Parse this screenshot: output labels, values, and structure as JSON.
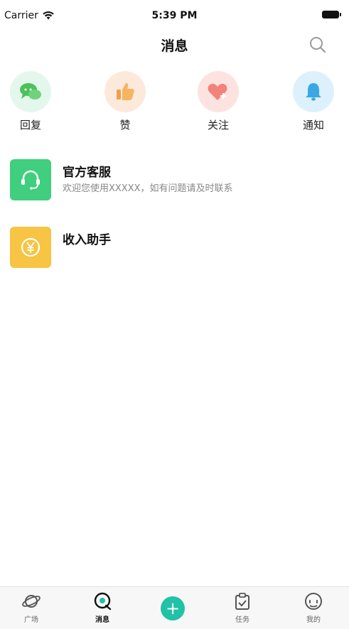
{
  "status_bar": {
    "carrier": "Carrier",
    "time": "5:39 PM"
  },
  "nav": {
    "title": "消息",
    "search_icon": "search-icon"
  },
  "quick_actions": [
    {
      "label": "回复",
      "icon": "chat-bubbles-icon",
      "bg": "#e4f7ec",
      "color": "#4cc25c"
    },
    {
      "label": "赞",
      "icon": "thumbs-up-icon",
      "bg": "#fde9dc",
      "color": "#f0a048"
    },
    {
      "label": "关注",
      "icon": "heart-plus-icon",
      "bg": "#fde3e0",
      "color": "#f2837b"
    },
    {
      "label": "通知",
      "icon": "bell-icon",
      "bg": "#dcf1fb",
      "color": "#3aa8e4"
    }
  ],
  "messages": [
    {
      "title": "官方客服",
      "subtitle": "欢迎您使用XXXXX，如有问题请及时联系",
      "icon": "headset-icon",
      "color": "#3fcf7e"
    },
    {
      "title": "收入助手",
      "subtitle": "",
      "icon": "yen-coin-icon",
      "color": "#f7c443"
    }
  ],
  "tab_bar": {
    "items": [
      {
        "label": "广场",
        "icon": "planet-icon"
      },
      {
        "label": "消息",
        "icon": "message-icon",
        "active": true
      },
      {
        "label": "",
        "icon": "plus-icon"
      },
      {
        "label": "任务",
        "icon": "task-icon"
      },
      {
        "label": "我的",
        "icon": "profile-icon"
      }
    ],
    "accent": "#21c2a7",
    "plus_symbol": "+"
  }
}
